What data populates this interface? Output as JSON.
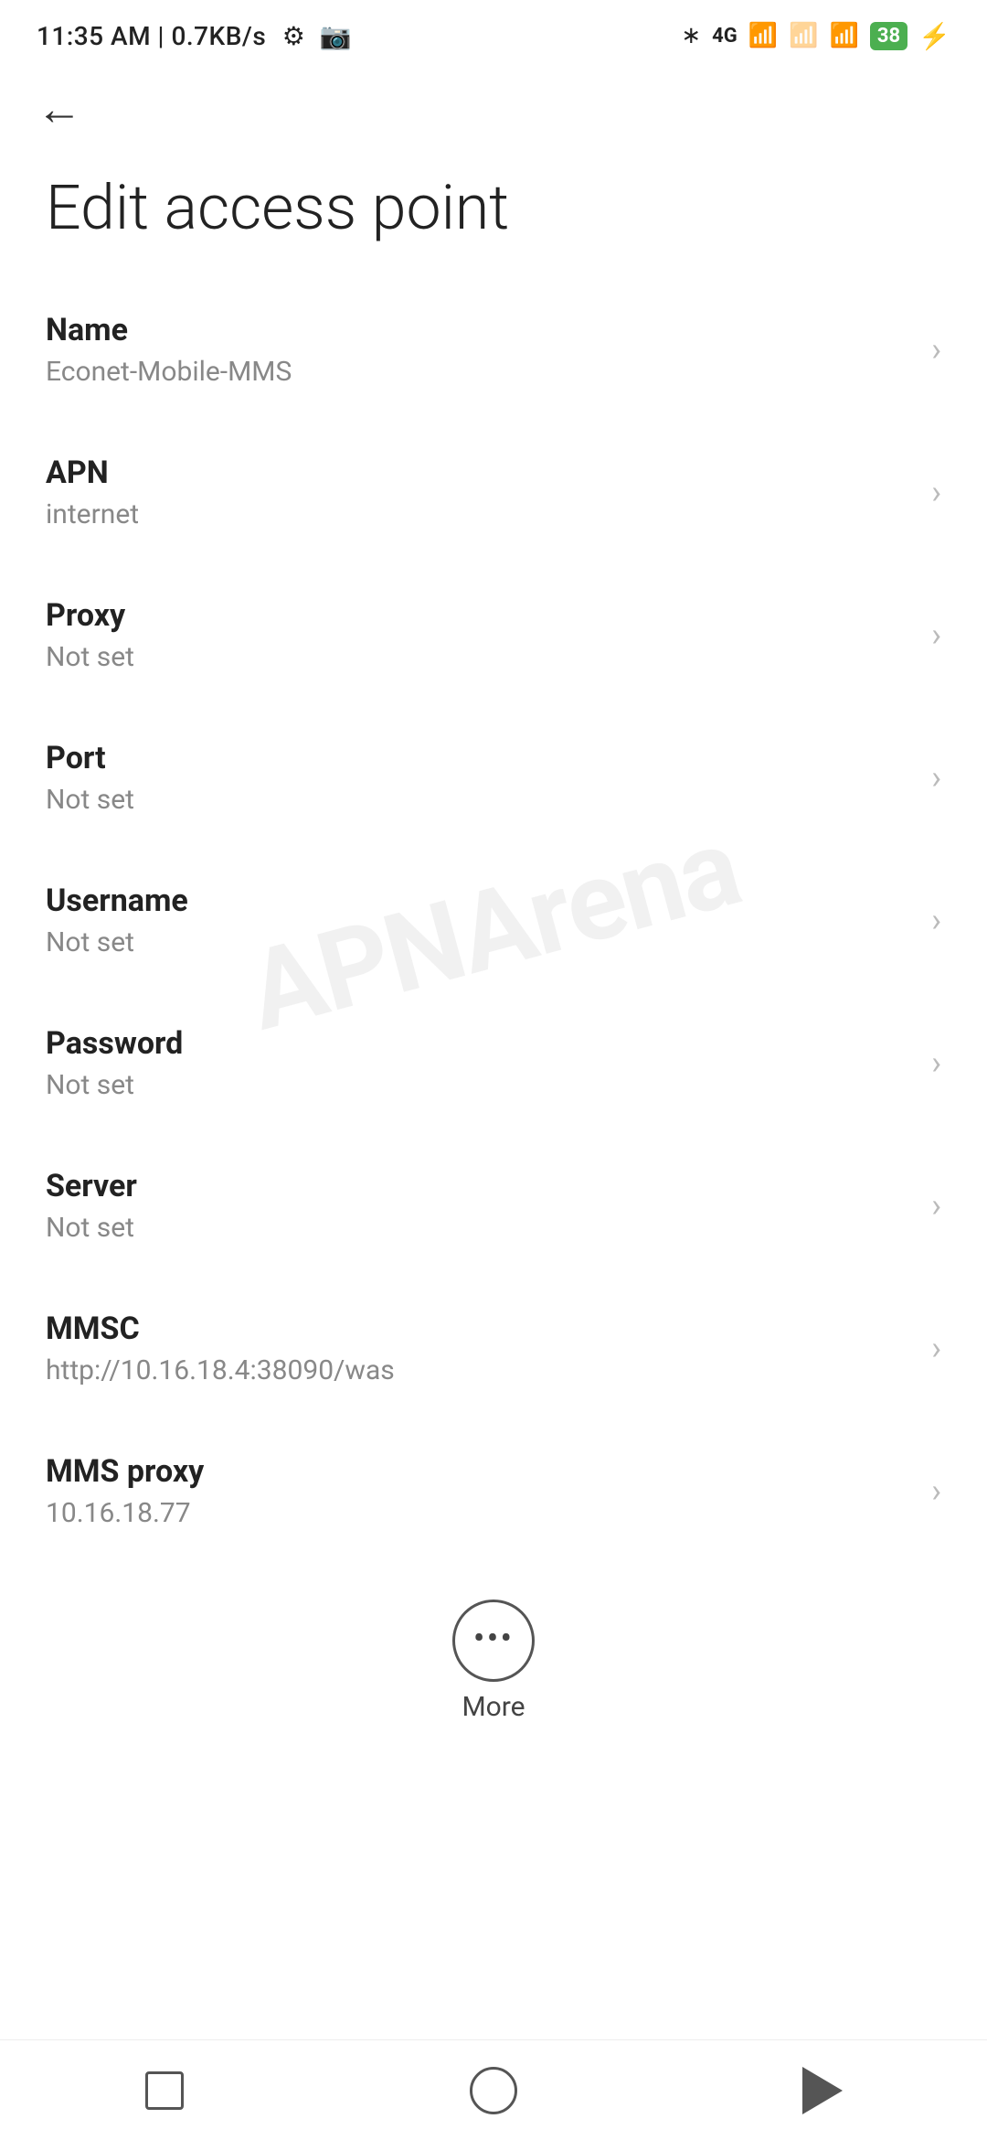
{
  "status_bar": {
    "time": "11:35 AM",
    "speed": "0.7KB/s"
  },
  "toolbar": {
    "back_label": "←"
  },
  "page": {
    "title": "Edit access point"
  },
  "settings_items": [
    {
      "label": "Name",
      "value": "Econet-Mobile-MMS"
    },
    {
      "label": "APN",
      "value": "internet"
    },
    {
      "label": "Proxy",
      "value": "Not set"
    },
    {
      "label": "Port",
      "value": "Not set"
    },
    {
      "label": "Username",
      "value": "Not set"
    },
    {
      "label": "Password",
      "value": "Not set"
    },
    {
      "label": "Server",
      "value": "Not set"
    },
    {
      "label": "MMSC",
      "value": "http://10.16.18.4:38090/was"
    },
    {
      "label": "MMS proxy",
      "value": "10.16.18.77"
    }
  ],
  "more_button": {
    "label": "More"
  },
  "watermark": {
    "text": "APNArena"
  },
  "nav_bar": {
    "square_label": "recent",
    "home_label": "home",
    "back_label": "back"
  }
}
